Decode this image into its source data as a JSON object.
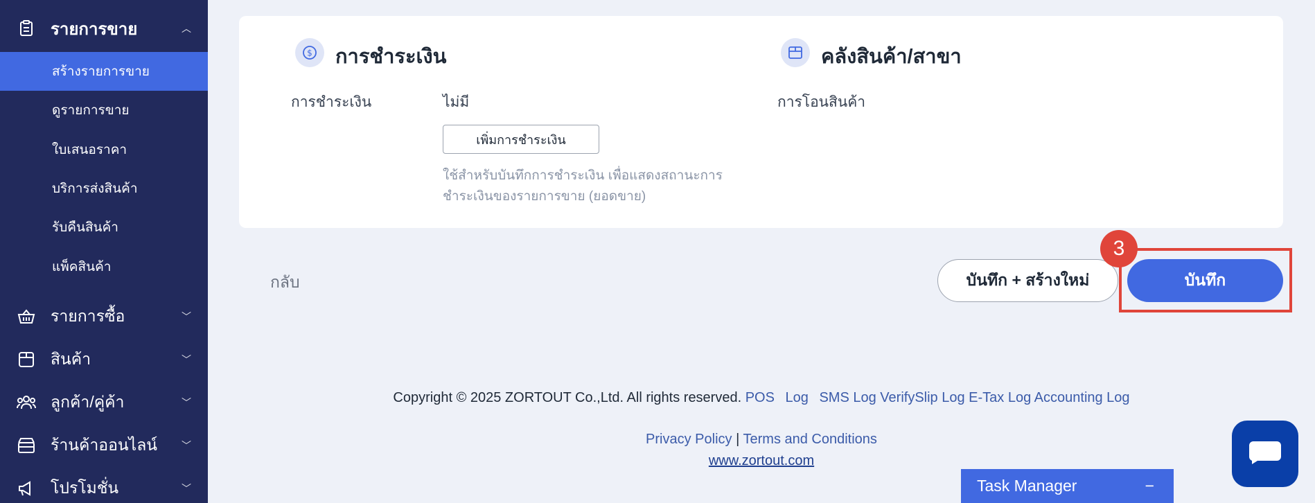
{
  "sidebar": {
    "sections": [
      {
        "label": "รายการขาย",
        "icon": "clipboard-icon",
        "open": true
      },
      {
        "label": "รายการซื้อ",
        "icon": "basket-icon"
      },
      {
        "label": "สินค้า",
        "icon": "box-icon"
      },
      {
        "label": "ลูกค้า/คู่ค้า",
        "icon": "people-icon"
      },
      {
        "label": "ร้านค้าออนไลน์",
        "icon": "store-icon"
      },
      {
        "label": "โปรโมชั่น",
        "icon": "megaphone-icon"
      }
    ],
    "sub_items": [
      {
        "label": "สร้างรายการขาย",
        "active": true
      },
      {
        "label": "ดูรายการขาย"
      },
      {
        "label": "ใบเสนอราคา"
      },
      {
        "label": "บริการส่งสินค้า"
      },
      {
        "label": "รับคืนสินค้า"
      },
      {
        "label": "แพ็คสินค้า"
      }
    ]
  },
  "payment": {
    "title": "การชำระเงิน",
    "field_label": "การชำระเงิน",
    "value": "ไม่มี",
    "add_button": "เพิ่มการชำระเงิน",
    "help_text": "ใช้สำหรับบันทึกการชำระเงิน เพื่อแสดงสถานะการชำระเงินของรายการขาย (ยอดขาย)"
  },
  "warehouse": {
    "title": "คลังสินค้า/สาขา",
    "field_label": "การโอนสินค้า"
  },
  "actions": {
    "back": "กลับ",
    "save_new": "บันทึก + สร้างใหม่",
    "save": "บันทึก",
    "step_number": "3"
  },
  "footer": {
    "copyright": "Copyright © 2025 ZORTOUT Co.,Ltd. All rights reserved.",
    "links": [
      "POS",
      "Log",
      "SMS Log",
      "VerifySlip Log",
      "E-Tax Log",
      "Accounting Log"
    ],
    "privacy": "Privacy Policy",
    "separator": "|",
    "terms": "Terms and Conditions",
    "website": "www.zortout.com"
  },
  "task_manager": {
    "label": "Task Manager",
    "toggle": "−"
  },
  "colors": {
    "sidebar_bg": "#222a5c",
    "accent": "#4169e1",
    "highlight": "#e0453a"
  }
}
